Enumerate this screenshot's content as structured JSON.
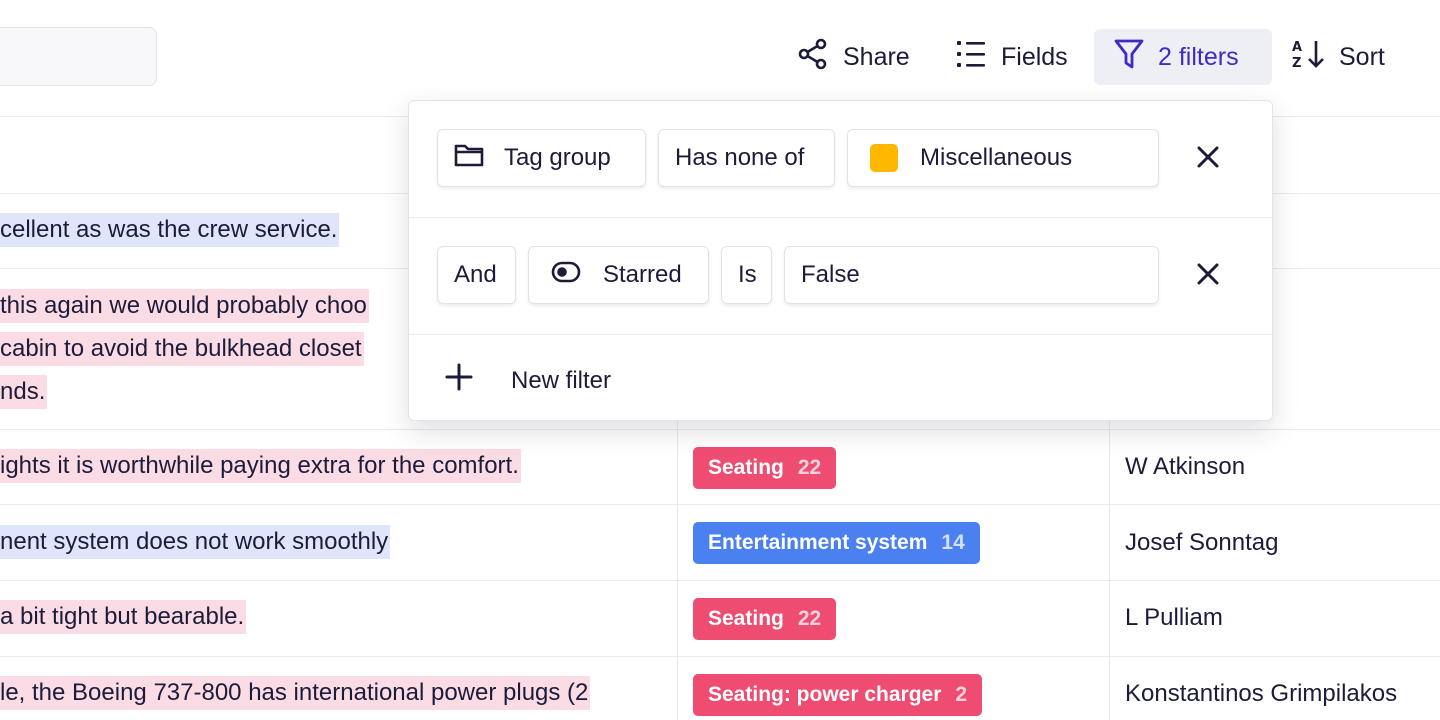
{
  "toolbar": {
    "share_label": "Share",
    "fields_label": "Fields",
    "filters_label": "2 filters",
    "sort_label": "Sort"
  },
  "colors": {
    "accent": "#3b2cc7",
    "tag_seating": "#ef4c72",
    "tag_entertainment": "#4a80f0",
    "highlight_blue": "#dfe6fb",
    "highlight_pink": "#fcdce4",
    "swatch_misc": "#ffb800"
  },
  "rows": [
    {
      "text_lines": [
        "cellent as was the crew service."
      ],
      "highlight": "blue"
    },
    {
      "text_lines": [
        " this again we would probably choo",
        " cabin to avoid the bulkhead closet",
        "nds."
      ],
      "highlight": "pink"
    },
    {
      "text_lines": [
        "ights it is worthwhile paying extra for the comfort."
      ],
      "highlight": "pink",
      "tag": {
        "label": "Seating",
        "count": "22",
        "color": "#ef4c72"
      },
      "person": "W Atkinson"
    },
    {
      "text_lines": [
        "nent system does not work smoothly"
      ],
      "highlight": "blue",
      "tag": {
        "label": "Entertainment system",
        "count": "14",
        "color": "#4a80f0"
      },
      "person": "Josef Sonntag"
    },
    {
      "text_lines": [
        "a bit tight but bearable."
      ],
      "highlight": "pink",
      "tag": {
        "label": "Seating",
        "count": "22",
        "color": "#ef4c72"
      },
      "person": "L Pulliam"
    },
    {
      "text_lines": [
        "le, the Boeing 737-800 has international power plugs (2"
      ],
      "highlight": "pink",
      "tag": {
        "label": "Seating: power charger",
        "count": "2",
        "color": "#ef4c72"
      },
      "person": "Konstantinos Grimpilakos"
    }
  ],
  "filter_popup": {
    "filters": [
      {
        "field_icon": "folder-icon",
        "field": "Tag group",
        "operator": "Has none of",
        "value": "Miscellaneous",
        "value_swatch": "#ffb800"
      },
      {
        "conjunction": "And",
        "field_icon": "toggle-icon",
        "field": "Starred",
        "operator": "Is",
        "value": "False"
      }
    ],
    "new_filter_label": "New filter"
  }
}
